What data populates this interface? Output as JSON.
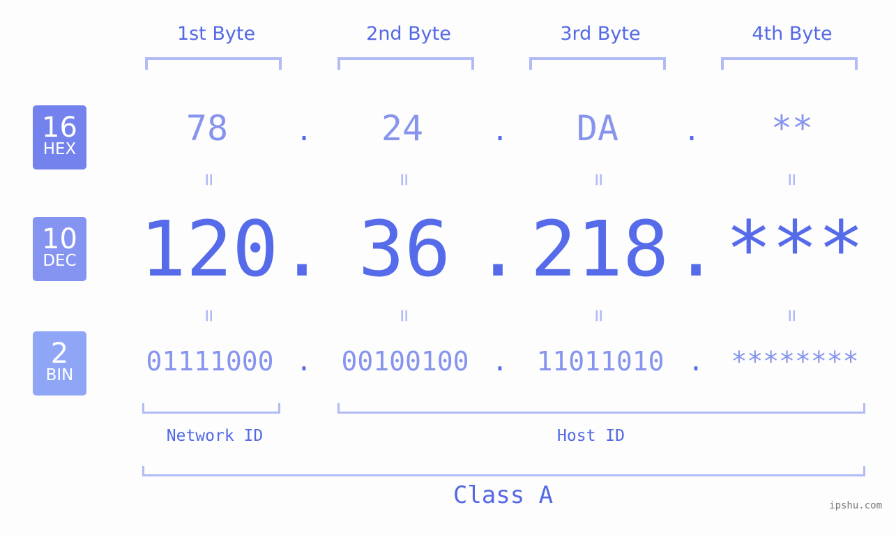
{
  "byte_labels": [
    "1st Byte",
    "2nd Byte",
    "3rd Byte",
    "4th Byte"
  ],
  "badges": [
    {
      "num": "16",
      "label": "HEX",
      "color": "#7382ec"
    },
    {
      "num": "10",
      "label": "DEC",
      "color": "#8594f0"
    },
    {
      "num": "2",
      "label": "BIN",
      "color": "#8fa6f6"
    }
  ],
  "hex": [
    "78",
    "24",
    "DA",
    "**"
  ],
  "dec": [
    "120",
    "36",
    "218",
    "***"
  ],
  "bin": [
    "01111000",
    "00100100",
    "11011010",
    "********"
  ],
  "separator": ".",
  "equals": "=",
  "network_id_label": "Network ID",
  "host_id_label": "Host ID",
  "class_label": "Class A",
  "watermark": "ipshu.com",
  "colors": {
    "accent": "#566be9",
    "light": "#b1bbf6",
    "mid": "#8794ee"
  }
}
